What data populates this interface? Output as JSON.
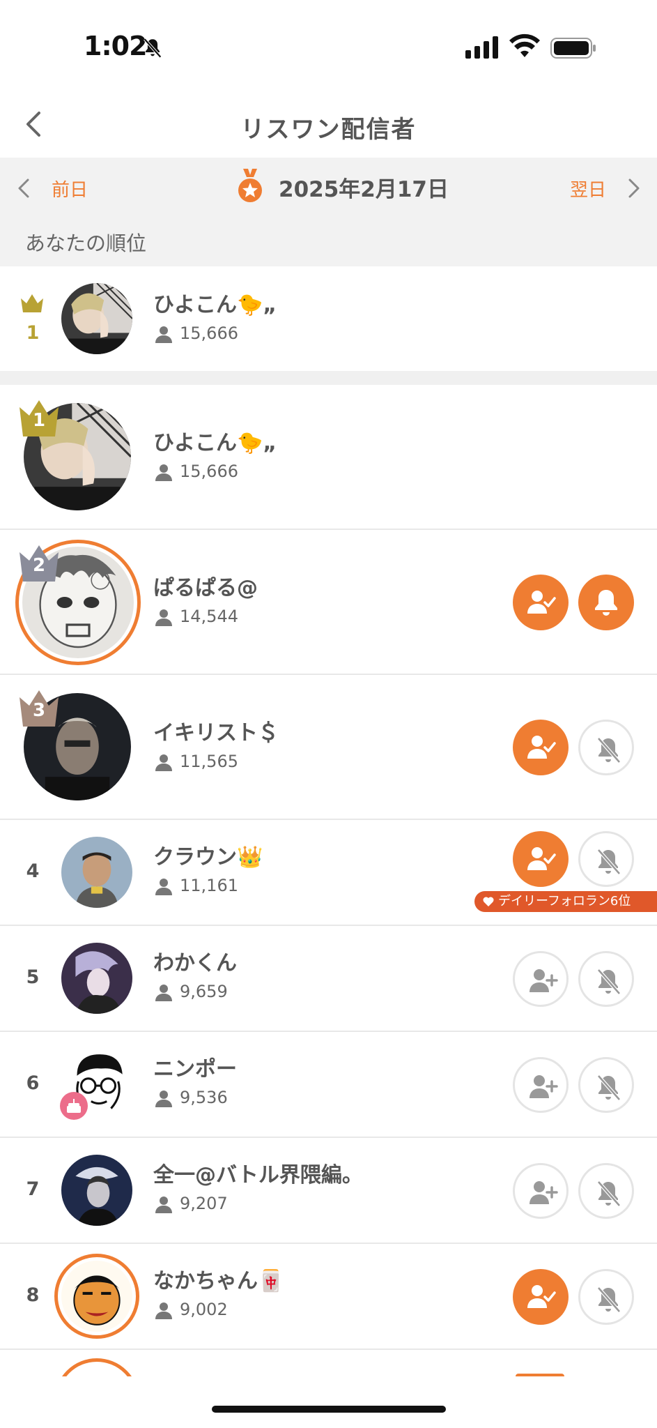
{
  "status_bar": {
    "time": "1:02"
  },
  "header": {
    "title": "リスワン配信者"
  },
  "date_nav": {
    "prev_label": "前日",
    "date": "2025年2月17日",
    "next_label": "翌日"
  },
  "your_rank_label": "あなたの順位",
  "my_entry": {
    "rank": "1",
    "name": "ひよこん🐤„",
    "count": "15,666"
  },
  "ranking": [
    {
      "rank": "1",
      "name": "ひよこん🐤„",
      "count": "15,666",
      "follow": null,
      "notify": null
    },
    {
      "rank": "2",
      "name": "ぱるぱる@",
      "count": "14,544",
      "follow": "following",
      "notify": "on"
    },
    {
      "rank": "3",
      "name": "イキリスト＄",
      "count": "11,565",
      "follow": "following",
      "notify": "off"
    },
    {
      "rank": "4",
      "name": "クラウン👑",
      "count": "11,161",
      "follow": "following",
      "notify": "off",
      "badge": "デイリーフォロラン6位"
    },
    {
      "rank": "5",
      "name": "わかくん",
      "count": "9,659",
      "follow": "not-following",
      "notify": "off"
    },
    {
      "rank": "6",
      "name": "ニンポー",
      "count": "9,536",
      "follow": "not-following",
      "notify": "off"
    },
    {
      "rank": "7",
      "name": "全一@バトル界隈編。",
      "count": "9,207",
      "follow": "not-following",
      "notify": "off"
    },
    {
      "rank": "8",
      "name": "なかちゃん🀄",
      "count": "9,002",
      "follow": "following",
      "notify": "off"
    }
  ],
  "icons": {
    "back": "chevron-left-icon",
    "medal": "medal-icon",
    "viewers": "person-icon",
    "follow_on": "user-check-icon",
    "follow_off": "user-plus-icon",
    "notify_on": "bell-icon",
    "notify_off": "bell-off-icon"
  },
  "colors": {
    "accent": "#ef7d32",
    "gold": "#b8a234",
    "silver": "#8a8c9a",
    "bronze": "#a58a7b",
    "badge_red": "#e0582a"
  }
}
